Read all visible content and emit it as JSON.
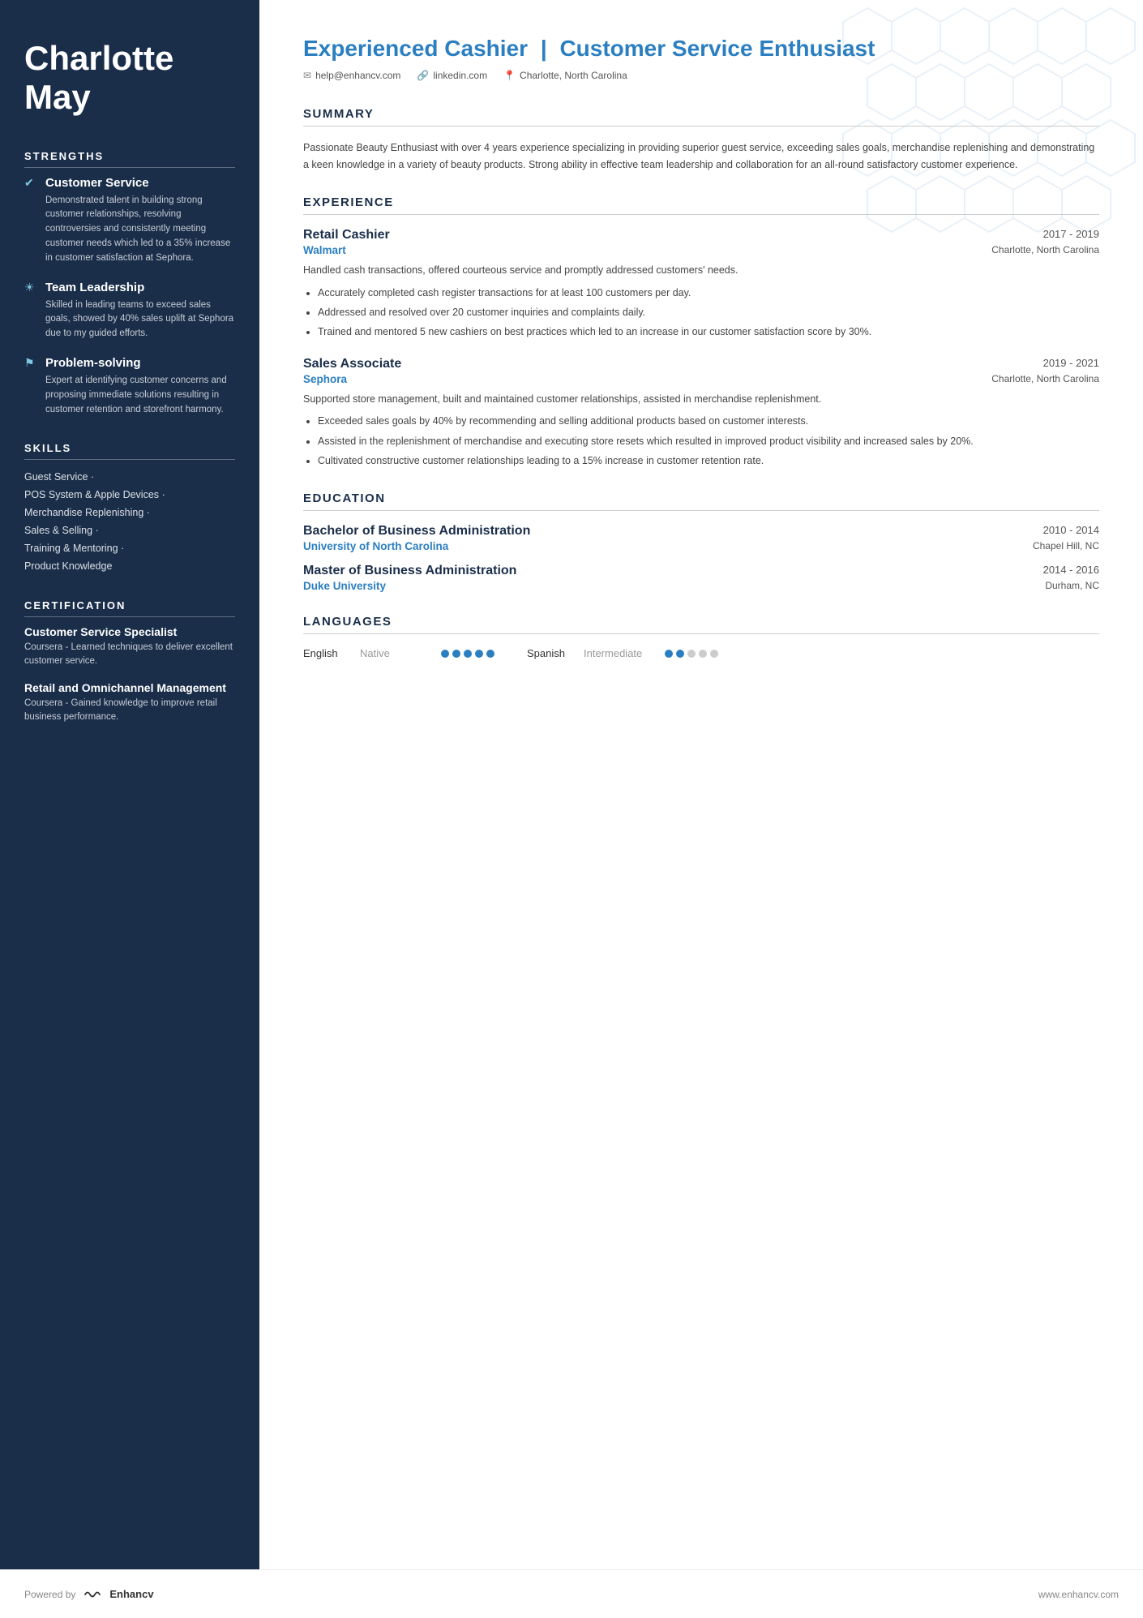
{
  "sidebar": {
    "name_line1": "Charlotte",
    "name_line2": "May",
    "strengths_title": "STRENGTHS",
    "strengths": [
      {
        "icon": "✔",
        "title": "Customer Service",
        "desc": "Demonstrated talent in building strong customer relationships, resolving controversies and consistently meeting customer needs which led to a 35% increase in customer satisfaction at Sephora."
      },
      {
        "icon": "☀",
        "title": "Team Leadership",
        "desc": "Skilled in leading teams to exceed sales goals, showed by 40% sales uplift at Sephora due to my guided efforts."
      },
      {
        "icon": "⚑",
        "title": "Problem-solving",
        "desc": "Expert at identifying customer concerns and proposing immediate solutions resulting in customer retention and storefront harmony."
      }
    ],
    "skills_title": "SKILLS",
    "skills": [
      "Guest Service ·",
      "POS System & Apple Devices ·",
      "Merchandise Replenishing ·",
      "Sales & Selling ·",
      "Training & Mentoring ·",
      "Product Knowledge"
    ],
    "cert_title": "CERTIFICATION",
    "certifications": [
      {
        "title": "Customer Service Specialist",
        "desc": "Coursera - Learned techniques to deliver excellent customer service."
      },
      {
        "title": "Retail and Omnichannel Management",
        "desc": "Coursera - Gained knowledge to improve retail business performance."
      }
    ]
  },
  "main": {
    "title_part1": "Experienced Cashier",
    "title_separator": "|",
    "title_part2": "Customer Service Enthusiast",
    "contact": {
      "email": "help@enhancv.com",
      "linkedin": "linkedin.com",
      "location": "Charlotte, North Carolina"
    },
    "summary_title": "SUMMARY",
    "summary_text": "Passionate Beauty Enthusiast with over 4 years experience specializing in providing superior guest service, exceeding sales goals, merchandise replenishing and demonstrating a keen knowledge in a variety of beauty products. Strong ability in effective team leadership and collaboration for an all-round satisfactory customer experience.",
    "experience_title": "EXPERIENCE",
    "experiences": [
      {
        "title": "Retail Cashier",
        "date": "2017 - 2019",
        "company": "Walmart",
        "location": "Charlotte, North Carolina",
        "summary": "Handled cash transactions, offered courteous service and promptly addressed customers' needs.",
        "bullets": [
          "Accurately completed cash register transactions for at least 100 customers per day.",
          "Addressed and resolved over 20 customer inquiries and complaints daily.",
          "Trained and mentored 5 new cashiers on best practices which led to an increase in our customer satisfaction score by 30%."
        ]
      },
      {
        "title": "Sales Associate",
        "date": "2019 - 2021",
        "company": "Sephora",
        "location": "Charlotte, North Carolina",
        "summary": "Supported store management, built and maintained customer relationships, assisted in merchandise replenishment.",
        "bullets": [
          "Exceeded sales goals by 40% by recommending and selling additional products based on customer interests.",
          "Assisted in the replenishment of merchandise and executing store resets which resulted in improved product visibility and increased sales by 20%.",
          "Cultivated constructive customer relationships leading to a 15% increase in customer retention rate."
        ]
      }
    ],
    "education_title": "EDUCATION",
    "education": [
      {
        "degree": "Bachelor of Business Administration",
        "date": "2010 - 2014",
        "school": "University of North Carolina",
        "location": "Chapel Hill, NC"
      },
      {
        "degree": "Master of Business Administration",
        "date": "2014 - 2016",
        "school": "Duke University",
        "location": "Durham, NC"
      }
    ],
    "languages_title": "LANGUAGES",
    "languages": [
      {
        "name": "English",
        "level": "Native",
        "filled": 5,
        "total": 5
      },
      {
        "name": "Spanish",
        "level": "Intermediate",
        "filled": 2,
        "total": 5
      }
    ]
  },
  "footer": {
    "powered_by": "Powered by",
    "brand": "Enhancv",
    "website": "www.enhancv.com"
  }
}
